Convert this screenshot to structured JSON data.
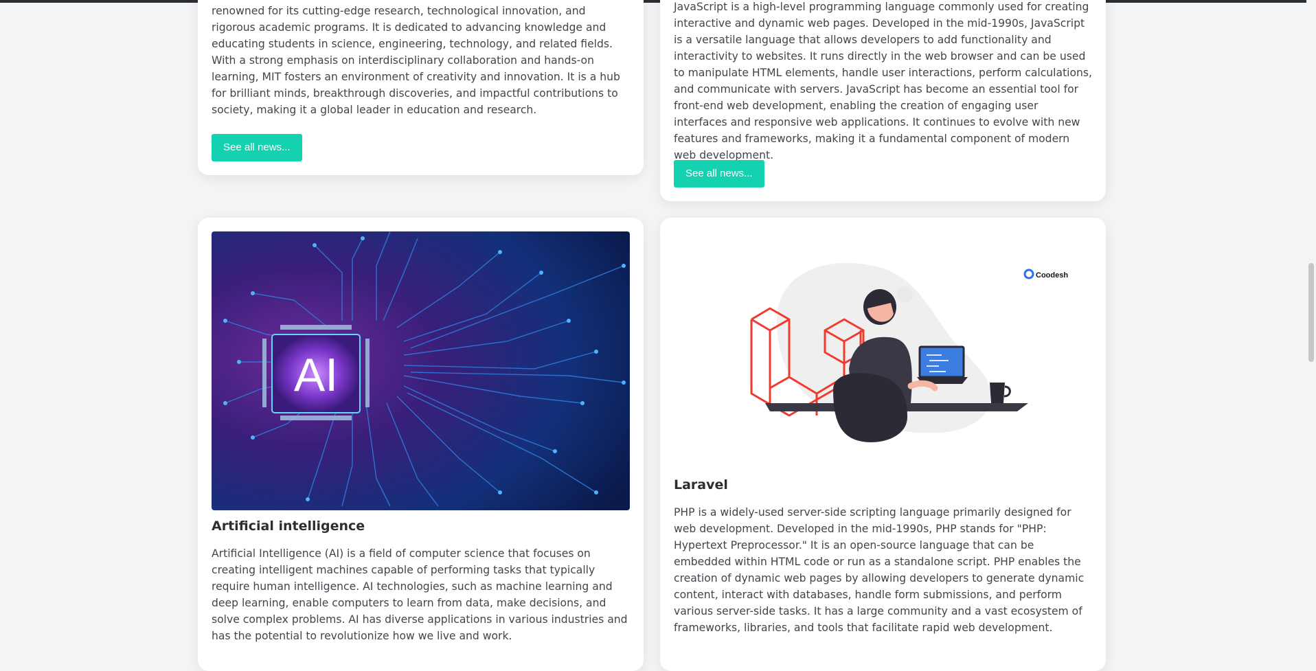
{
  "cards": [
    {
      "text": "renowned for its cutting-edge research, technological innovation, and rigorous academic programs. It is dedicated to advancing knowledge and educating students in science, engineering, technology, and related fields. With a strong emphasis on interdisciplinary collaboration and hands-on learning, MIT fosters an environment of creativity and innovation. It is a hub for brilliant minds, breakthrough discoveries, and impactful contributions to society, making it a global leader in education and research.",
      "button": "See all news..."
    },
    {
      "text": "JavaScript is a high-level programming language commonly used for creating interactive and dynamic web pages. Developed in the mid-1990s, JavaScript is a versatile language that allows developers to add functionality and interactivity to websites. It runs directly in the web browser and can be used to manipulate HTML elements, handle user interactions, perform calculations, and communicate with servers. JavaScript has become an essential tool for front-end web development, enabling the creation of engaging user interfaces and responsive web applications. It continues to evolve with new features and frameworks, making it a fundamental component of modern web development.",
      "button": "See all news..."
    },
    {
      "image_text": "AI",
      "title": "Artificial intelligence",
      "text": "Artificial Intelligence (AI) is a field of computer science that focuses on creating intelligent machines capable of performing tasks that typically require human intelligence. AI technologies, such as machine learning and deep learning, enable computers to learn from data, make decisions, and solve complex problems. AI has diverse applications in various industries and has the potential to revolutionize how we live and work."
    },
    {
      "image_brand": "Coodesh",
      "title": "Laravel",
      "text": "PHP is a widely-used server-side scripting language primarily designed for web development. Developed in the mid-1990s, PHP stands for \"PHP: Hypertext Preprocessor.\" It is an open-source language that can be embedded within HTML code or run as a standalone script. PHP enables the creation of dynamic web pages by allowing developers to generate dynamic content, interact with databases, handle form submissions, and perform various server-side tasks. It has a large community and a vast ecosystem of frameworks, libraries, and tools that facilitate rapid web development."
    }
  ],
  "colors": {
    "button": "#14d1b0",
    "laravel_red": "#ef3b2d",
    "ai_bg_dark": "#0b1f5c",
    "ai_glow": "#8a3fd1"
  }
}
